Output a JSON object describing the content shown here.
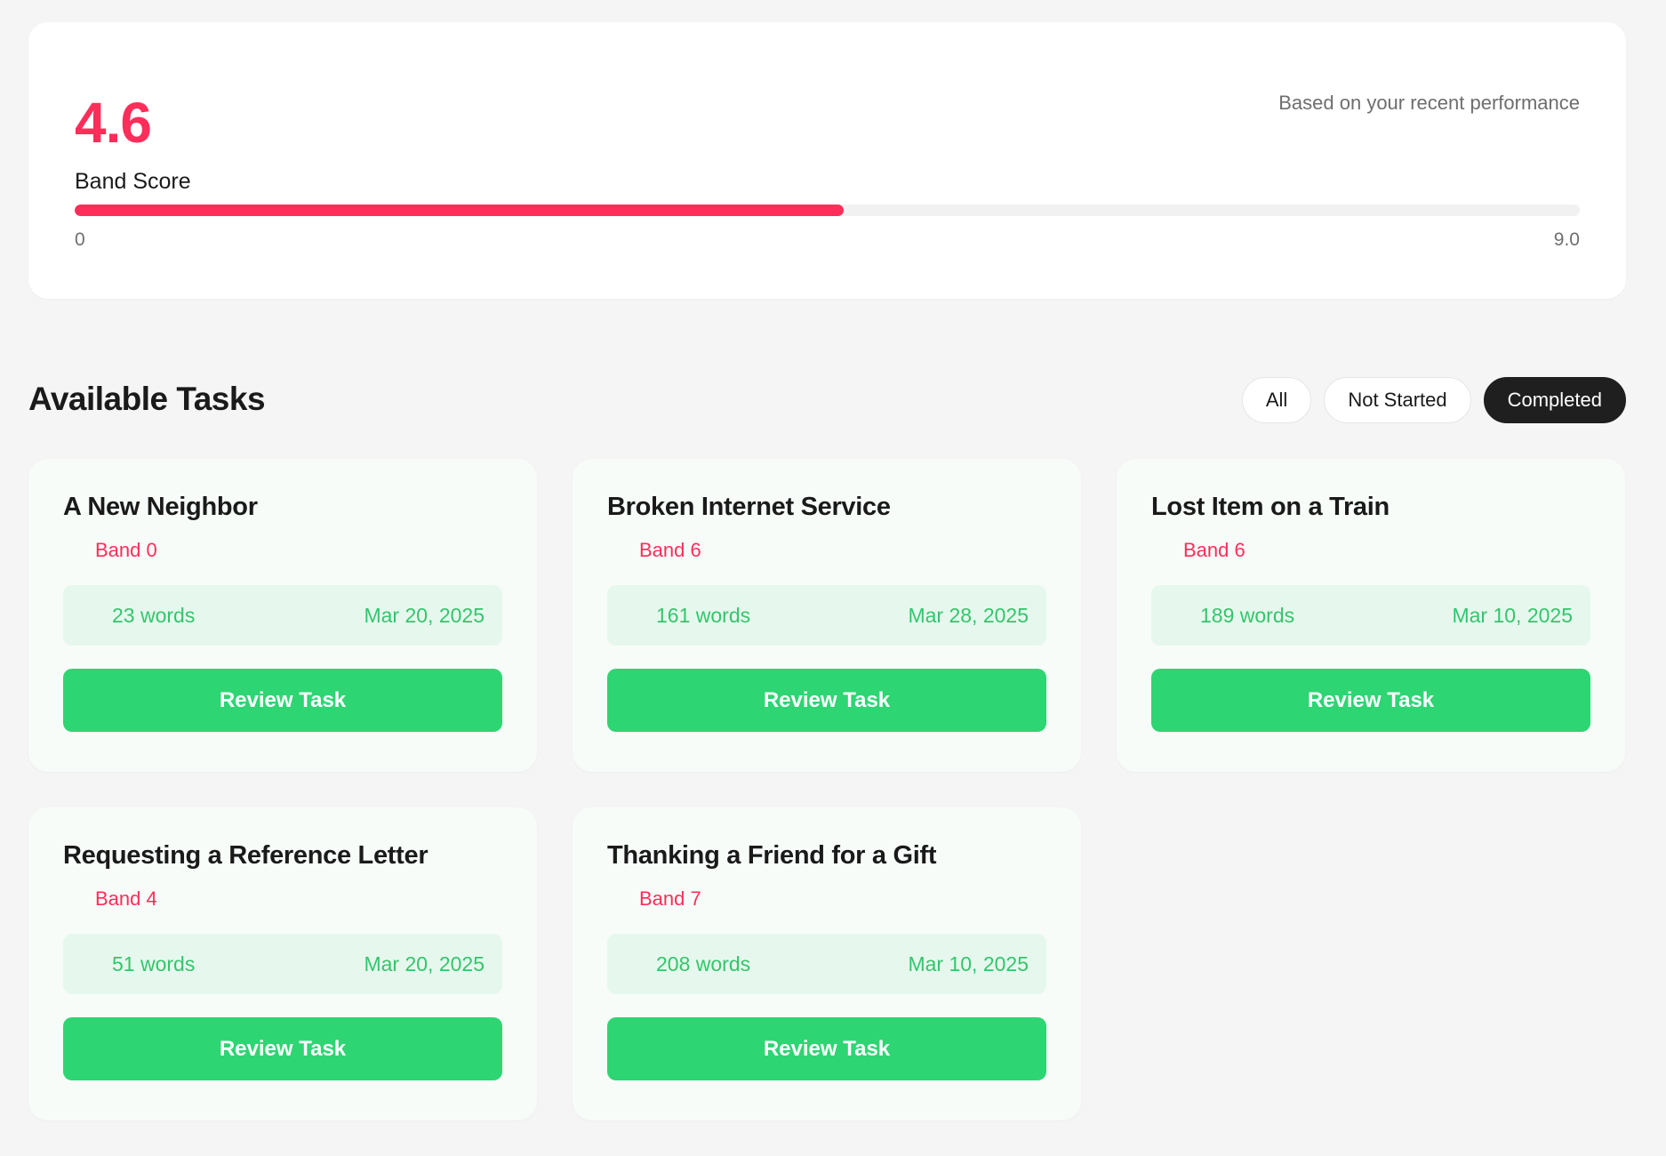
{
  "colors": {
    "accent_red": "#ff2d5a",
    "accent_green": "#2ed573",
    "meta_bg": "#e6f8ed",
    "meta_text": "#34c56d"
  },
  "score": {
    "value": "4.6",
    "label": "Band Score",
    "note": "Based on your recent performance",
    "min": "0",
    "max": "9.0",
    "progress_fraction": 0.511
  },
  "tasks_section": {
    "title": "Available Tasks",
    "filters": [
      {
        "label": "All",
        "active": false
      },
      {
        "label": "Not Started",
        "active": false
      },
      {
        "label": "Completed",
        "active": true
      }
    ]
  },
  "tasks": [
    {
      "title": "A New Neighbor",
      "band": "Band 0",
      "words": "23 words",
      "date": "Mar 20, 2025",
      "button": "Review Task"
    },
    {
      "title": "Broken Internet Service",
      "band": "Band 6",
      "words": "161 words",
      "date": "Mar 28, 2025",
      "button": "Review Task"
    },
    {
      "title": "Lost Item on a Train",
      "band": "Band 6",
      "words": "189 words",
      "date": "Mar 10, 2025",
      "button": "Review Task"
    },
    {
      "title": "Requesting a Reference Letter",
      "band": "Band 4",
      "words": "51 words",
      "date": "Mar 20, 2025",
      "button": "Review Task"
    },
    {
      "title": "Thanking a Friend for a Gift",
      "band": "Band 7",
      "words": "208 words",
      "date": "Mar 10, 2025",
      "button": "Review Task"
    }
  ]
}
